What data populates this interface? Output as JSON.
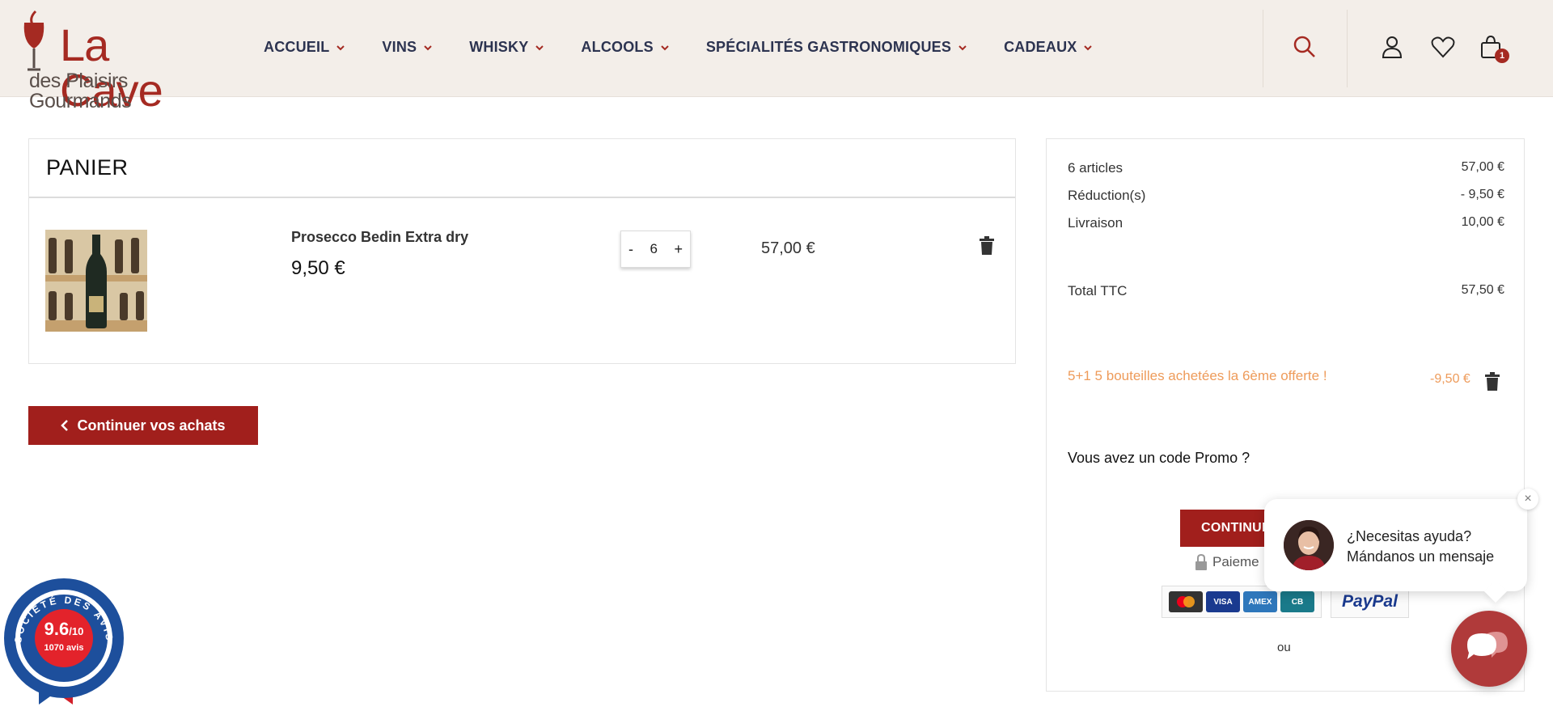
{
  "logo": {
    "main": "La Cave",
    "sub": "des Plaisirs Gourmands"
  },
  "nav": [
    {
      "label": "ACCUEIL"
    },
    {
      "label": "VINS"
    },
    {
      "label": "WHISKY"
    },
    {
      "label": "ALCOOLS"
    },
    {
      "label": "SPÉCIALITÉS GASTRONOMIQUES"
    },
    {
      "label": "CADEAUX"
    }
  ],
  "header_icons": {
    "search": "search-icon",
    "account": "user-icon",
    "wishlist": "heart-icon",
    "cart": "shopping-bag-icon",
    "cart_count": "1"
  },
  "cart": {
    "title": "PANIER",
    "item": {
      "name": "Prosecco Bedin Extra dry",
      "unit_price": "9,50 €",
      "qty_minus": "-",
      "quantity": "6",
      "qty_plus": "+",
      "line_total": "57,00 €"
    },
    "continue_label": "Continuer vos achats"
  },
  "summary": {
    "articles_label": "6 articles",
    "articles_value": "57,00 €",
    "reduction_label": "Réduction(s)",
    "reduction_value": "- 9,50 €",
    "shipping_label": "Livraison",
    "shipping_value": "10,00 €",
    "total_label": "Total TTC",
    "total_value": "57,50 €",
    "promo_line": "5+1 5 bouteilles achetées la 6ème offerte !",
    "promo_value": "-9,50 €",
    "promo_question": "Vous avez un code Promo ?",
    "checkout_label": "CONTINUE",
    "secure_label": "Paieme",
    "cards": [
      "mastercard",
      "VISA",
      "AMEX",
      "CB"
    ],
    "paypal": "PayPal",
    "or_label": "ou"
  },
  "chat": {
    "line1": "¿Necesitas ayuda?",
    "line2": "Mándanos un mensaje",
    "close": "×"
  },
  "reviews_badge": {
    "score": "9.6",
    "out_of": "/10",
    "count": "1070 avis",
    "ring_text": "SOCIÉTÉ DES AVIS GARANTIS"
  },
  "colors": {
    "brand": "#a11f1c",
    "nav": "#2c3350",
    "header_bg": "#f3eee9",
    "promo": "#ee9b5a"
  }
}
